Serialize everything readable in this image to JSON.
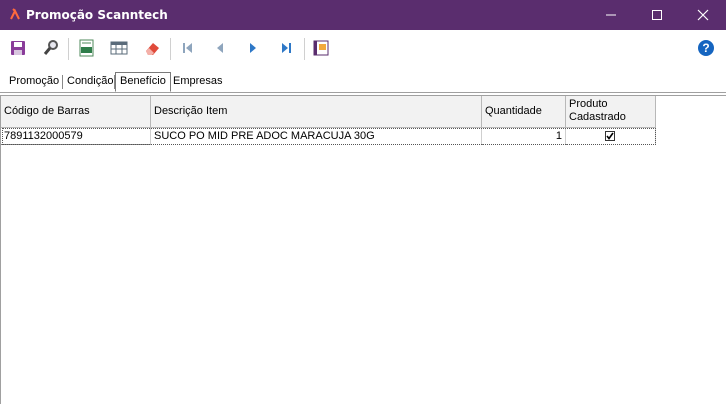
{
  "window": {
    "title": "Promoção Scanntech"
  },
  "toolbar": {
    "buttons": [
      "save-icon",
      "search-icon",
      "excel-export-icon",
      "table-icon",
      "eraser-icon",
      "first-record-icon",
      "previous-record-icon",
      "next-record-icon",
      "last-record-icon",
      "report-icon",
      "help-icon"
    ]
  },
  "tabs": [
    {
      "label": "Promoção"
    },
    {
      "label": "Condição"
    },
    {
      "label": "Benefício"
    },
    {
      "label": "Empresas"
    }
  ],
  "active_tab": "Benefício",
  "grid": {
    "columns": [
      {
        "label": "Código de Barras"
      },
      {
        "label": "Descrição Item"
      },
      {
        "label": "Quantidade"
      },
      {
        "label": "Produto Cadastrado"
      }
    ],
    "rows": [
      {
        "codigo": "7891132000579",
        "descricao": "SUCO PO MID PRE ADOC MARACUJA 30G",
        "quantidade": "1",
        "cadastrado": true
      }
    ]
  },
  "colors": {
    "titlebar": "#5a2d6e",
    "toolbar_icon_purple": "#8a3d9a",
    "help_blue": "#1565c0"
  }
}
